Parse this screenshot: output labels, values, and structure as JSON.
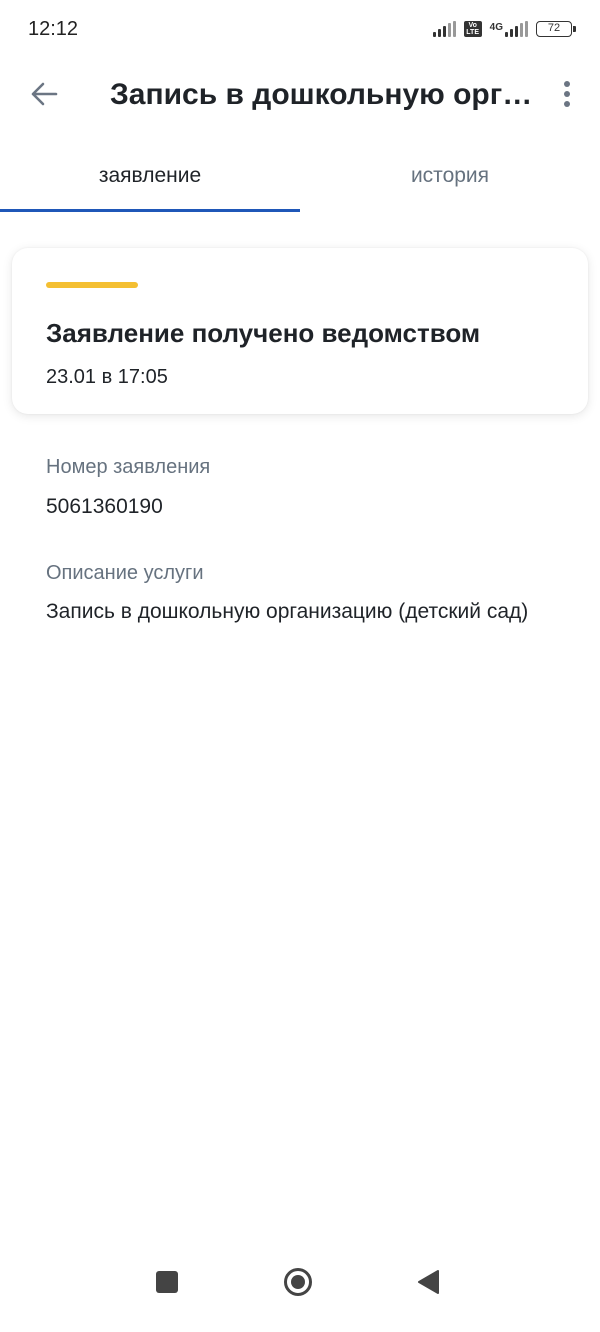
{
  "status_bar": {
    "time": "12:12",
    "volte": "Vo LTE",
    "network": "4G",
    "battery": "72"
  },
  "app_bar": {
    "title": "Запись в дошкольную орг…",
    "back_icon": "arrow-left-icon",
    "more_icon": "more-vertical-icon"
  },
  "tabs": [
    {
      "label": "заявление",
      "active": true
    },
    {
      "label": "история",
      "active": false
    }
  ],
  "status_card": {
    "title": "Заявление получено ведомством",
    "datetime": "23.01 в 17:05",
    "accent_color": "#f4bf32"
  },
  "details": {
    "number_label": "Номер заявления",
    "number_value": "5061360190",
    "description_label": "Описание услуги",
    "description_value": "Запись в дошкольную организацию (детский сад)"
  },
  "colors": {
    "active_tab_indicator": "#1f57b8",
    "label_gray": "#66727f",
    "text_dark": "#1f2328"
  }
}
